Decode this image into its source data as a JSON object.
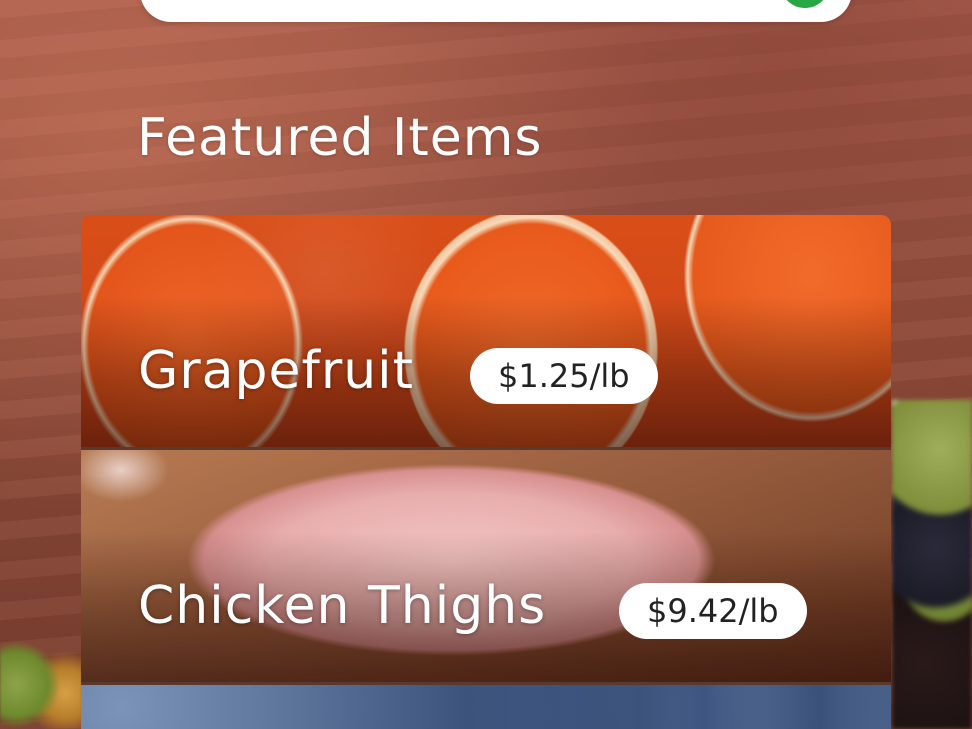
{
  "section": {
    "title": "Featured Items"
  },
  "items": [
    {
      "name": "Grapefruit",
      "price": "$1.25/lb"
    },
    {
      "name": "Chicken Thighs",
      "price": "$9.42/lb"
    },
    {
      "name": "",
      "price": ""
    }
  ],
  "colors": {
    "accent_green": "#28a745",
    "text_white": "#ffffff",
    "price_pill_bg": "#ffffff",
    "price_pill_text": "#222222"
  },
  "icons": {
    "search_submit": "search-submit-icon"
  }
}
